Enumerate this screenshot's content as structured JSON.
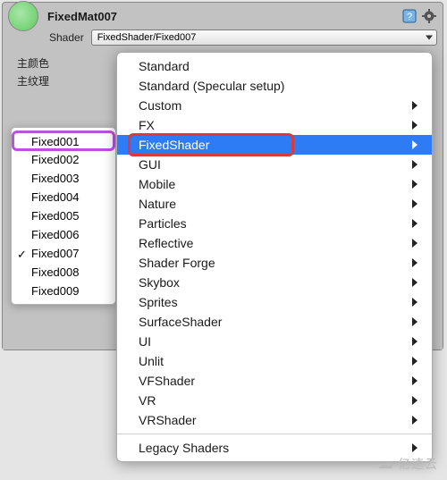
{
  "material": {
    "name": "FixedMat007",
    "shader_label": "Shader",
    "shader_value": "FixedShader/Fixed007"
  },
  "props": {
    "main_color": "主颜色",
    "main_texture": "主纹理"
  },
  "submenu": {
    "items": [
      {
        "label": "Fixed001",
        "checked": false
      },
      {
        "label": "Fixed002",
        "checked": false
      },
      {
        "label": "Fixed003",
        "checked": false
      },
      {
        "label": "Fixed004",
        "checked": false
      },
      {
        "label": "Fixed005",
        "checked": false
      },
      {
        "label": "Fixed006",
        "checked": false
      },
      {
        "label": "Fixed007",
        "checked": true
      },
      {
        "label": "Fixed008",
        "checked": false
      },
      {
        "label": "Fixed009",
        "checked": false
      }
    ]
  },
  "mainmenu": {
    "items": [
      {
        "label": "Standard",
        "submenu": false
      },
      {
        "label": "Standard (Specular setup)",
        "submenu": false
      },
      {
        "label": "Custom",
        "submenu": true
      },
      {
        "label": "FX",
        "submenu": true
      },
      {
        "label": "FixedShader",
        "submenu": true,
        "highlight": true
      },
      {
        "label": "GUI",
        "submenu": true
      },
      {
        "label": "Mobile",
        "submenu": true
      },
      {
        "label": "Nature",
        "submenu": true
      },
      {
        "label": "Particles",
        "submenu": true
      },
      {
        "label": "Reflective",
        "submenu": true
      },
      {
        "label": "Shader Forge",
        "submenu": true
      },
      {
        "label": "Skybox",
        "submenu": true
      },
      {
        "label": "Sprites",
        "submenu": true
      },
      {
        "label": "SurfaceShader",
        "submenu": true
      },
      {
        "label": "UI",
        "submenu": true
      },
      {
        "label": "Unlit",
        "submenu": true
      },
      {
        "label": "VFShader",
        "submenu": true
      },
      {
        "label": "VR",
        "submenu": true
      },
      {
        "label": "VRShader",
        "submenu": true
      }
    ],
    "legacy": "Legacy Shaders"
  },
  "watermark": "亿速云"
}
